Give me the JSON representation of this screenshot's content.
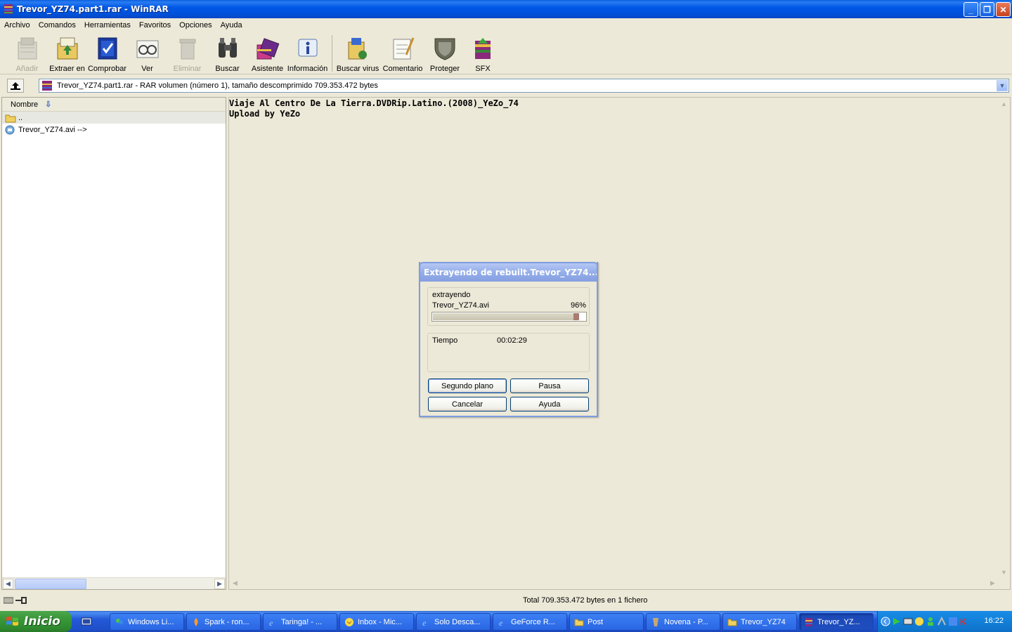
{
  "window": {
    "title": "Trevor_YZ74.part1.rar - WinRAR"
  },
  "menu": [
    "Archivo",
    "Comandos",
    "Herramientas",
    "Favoritos",
    "Opciones",
    "Ayuda"
  ],
  "toolbar": {
    "add": "Añadir",
    "extract": "Extraer en",
    "test": "Comprobar",
    "view": "Ver",
    "delete": "Eliminar",
    "find": "Buscar",
    "wizard": "Asistente",
    "info": "Información",
    "virus": "Buscar virus",
    "comment": "Comentario",
    "protect": "Proteger",
    "sfx": "SFX"
  },
  "address": {
    "text": "Trevor_YZ74.part1.rar - RAR volumen (número 1), tamaño descomprimido 709.353.472 bytes"
  },
  "filelist": {
    "column": "Nombre",
    "rows": [
      "..",
      "Trevor_YZ74.avi -->"
    ]
  },
  "comment": {
    "line1": "Viaje Al Centro De La Tierra.DVDRip.Latino.(2008)_YeZo_74",
    "line2": "Upload by YeZo"
  },
  "status": {
    "total": "Total 709.353.472 bytes en 1 fichero"
  },
  "dialog": {
    "title": "Extrayendo de rebuilt.Trevor_YZ74....",
    "action": "extrayendo",
    "file": "Trevor_YZ74.avi",
    "percent": "96%",
    "progress": 0.96,
    "time_label": "Tiempo",
    "time_value": "00:02:29",
    "btn_background": "Segundo plano",
    "btn_pause": "Pausa",
    "btn_cancel": "Cancelar",
    "btn_help": "Ayuda"
  },
  "taskbar": {
    "start": "Inicio",
    "tasks": [
      "Windows Li...",
      "Spark - ron...",
      "Taringa! - ...",
      "Inbox - Mic...",
      "Solo Desca...",
      "GeForce R...",
      "Post",
      "Novena - P...",
      "Trevor_YZ74",
      "Trevor_YZ..."
    ],
    "clock": "16:22"
  }
}
